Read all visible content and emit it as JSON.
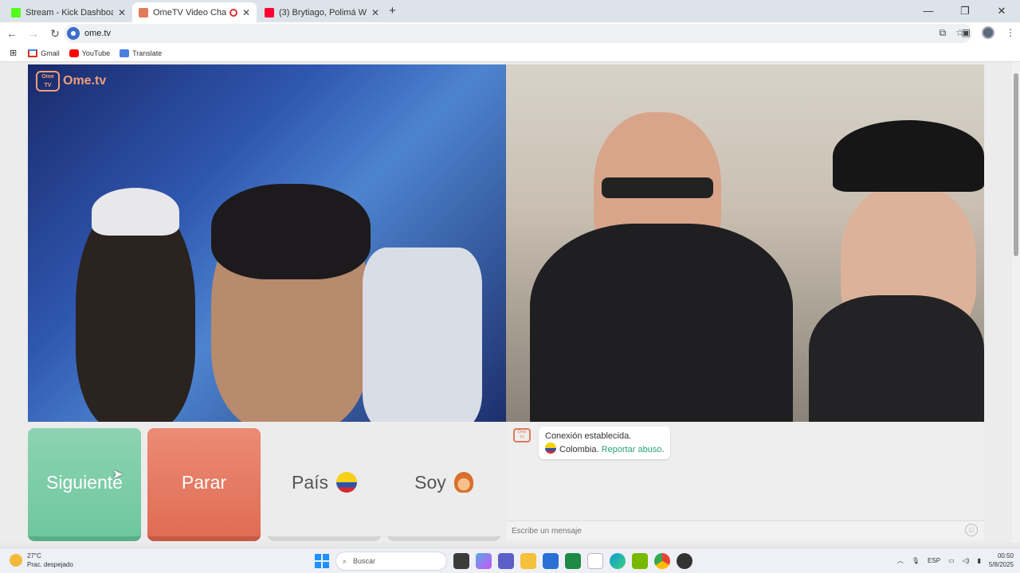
{
  "browser": {
    "tabs": [
      {
        "title": "Stream - Kick Dashboard",
        "favicon_color": "#53fc18",
        "active": false
      },
      {
        "title": "OmeTV Video Chat — Ome",
        "favicon_color": "#e07a5a",
        "active": true
      },
      {
        "title": "(3) Brytiago, Polimá Westcoast",
        "favicon_color": "#ff0033",
        "active": false
      }
    ],
    "new_tab_glyph": "+",
    "url": "ome.tv",
    "bookmarks": [
      {
        "label": "Gmail",
        "icon": "gmail-icon"
      },
      {
        "label": "YouTube",
        "icon": "youtube-icon"
      },
      {
        "label": "Translate",
        "icon": "translate-icon"
      }
    ]
  },
  "ometv": {
    "logo_text": "Ome.tv",
    "logo_badge": "Ome TV",
    "buttons": {
      "next": "Siguiente",
      "stop": "Parar",
      "country": "País",
      "gender": "Soy"
    },
    "chat": {
      "status": "Conexión establecida.",
      "country": "Colombia.",
      "report": "Reportar abuso",
      "report_suffix": ".",
      "placeholder": "Escribe un mensaje"
    }
  },
  "taskbar": {
    "temperature": "27°C",
    "weather": "Prac. despejado",
    "search": "Buscar",
    "language": "ESP",
    "time": "00:50",
    "date": "5/8/2025"
  },
  "colors": {
    "next": "#7bcca7",
    "stop": "#e67a63",
    "link": "#2aa37a"
  }
}
